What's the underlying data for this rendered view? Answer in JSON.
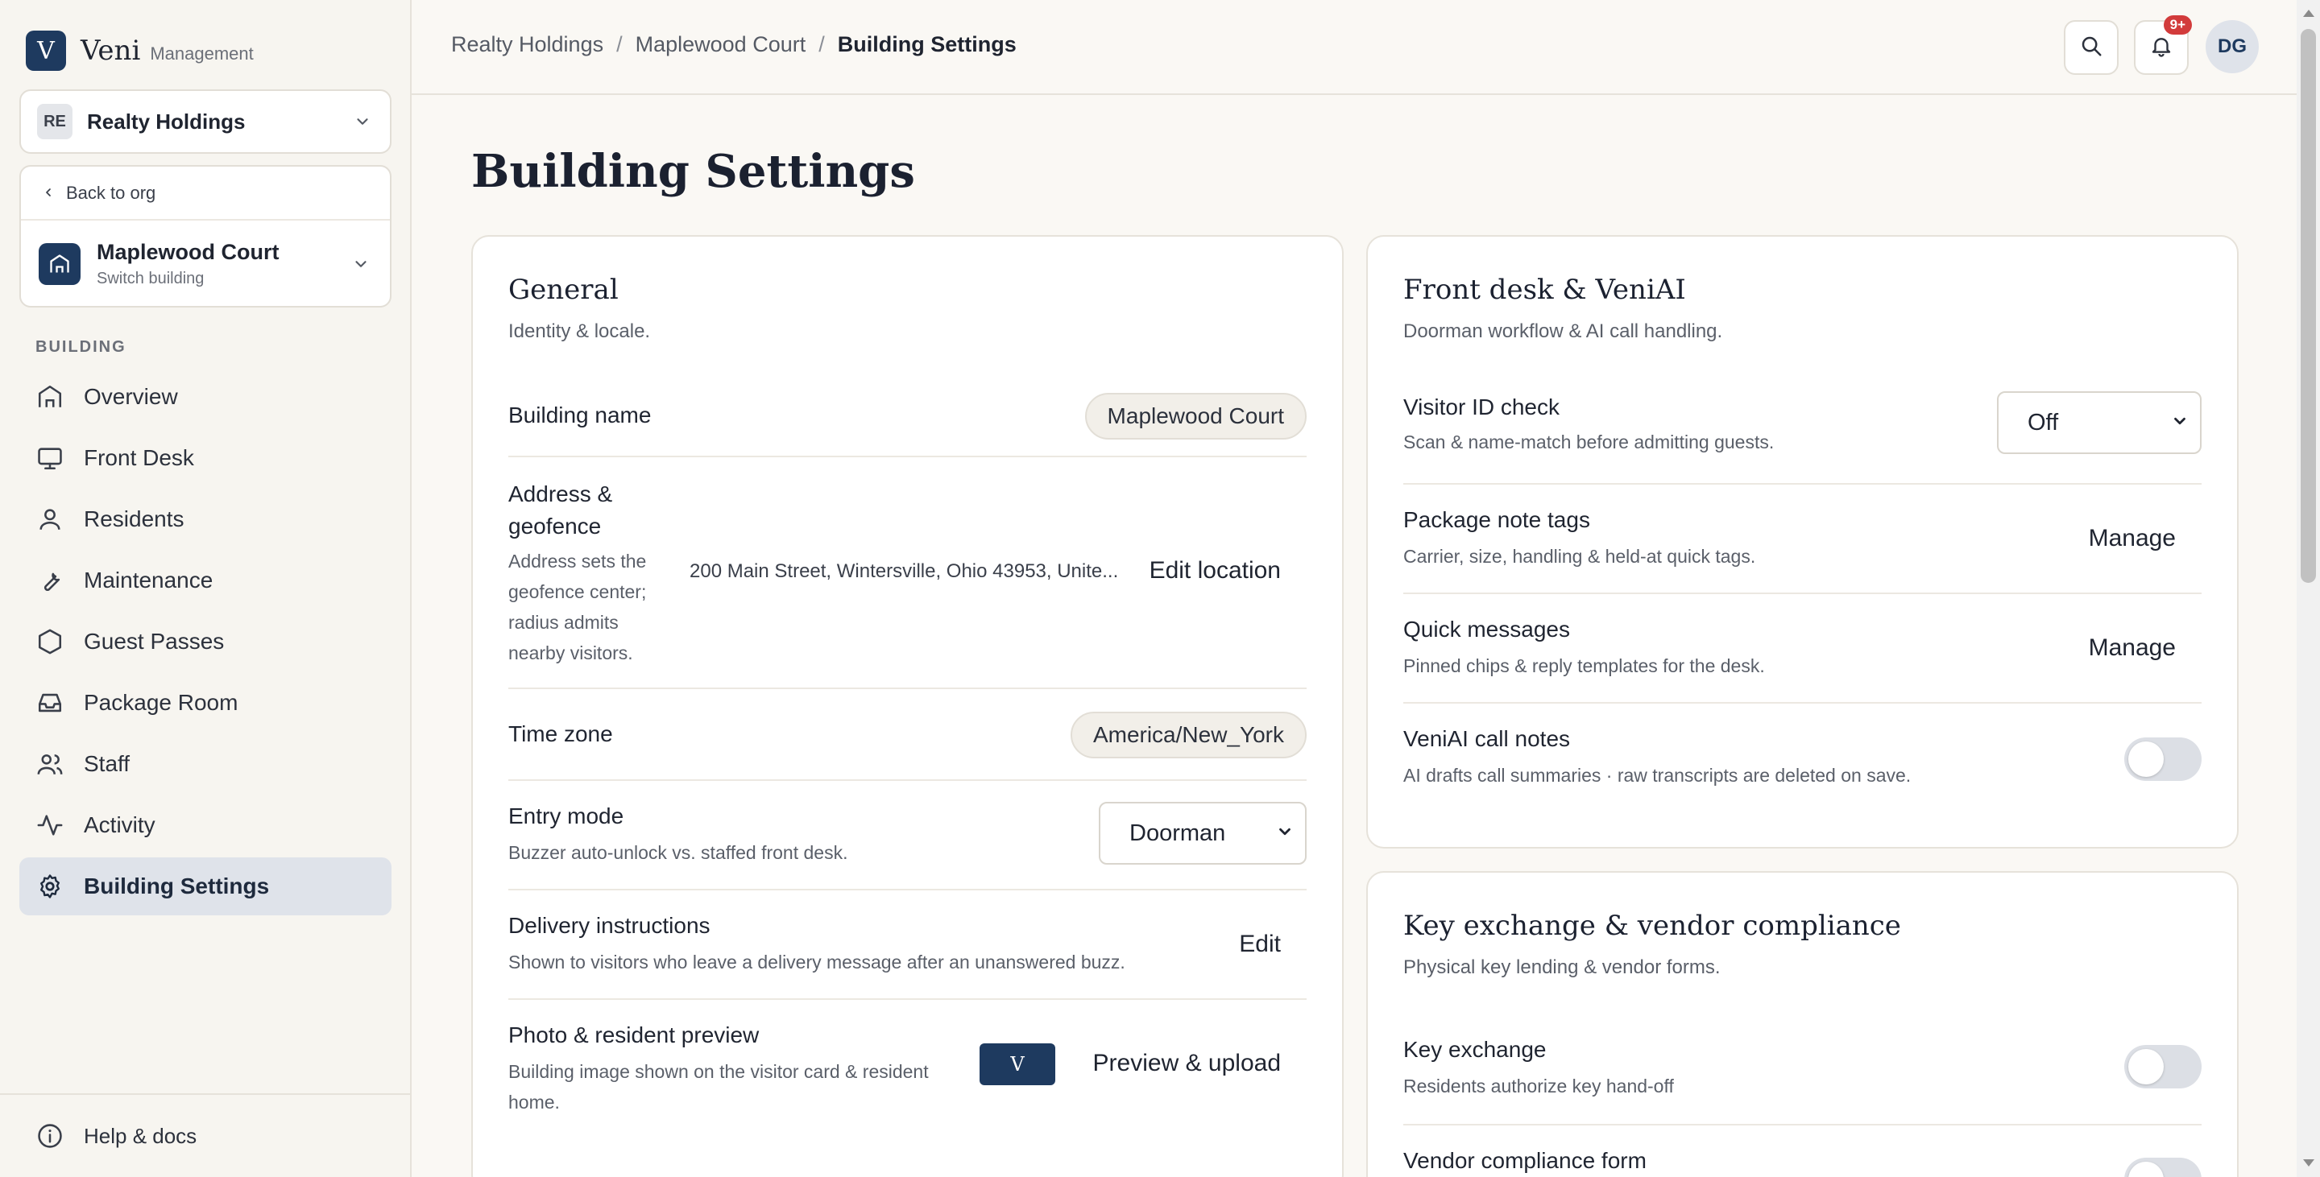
{
  "brand": {
    "logo_letter": "V",
    "name": "Veni",
    "sub": "Management"
  },
  "org": {
    "initials": "RE",
    "name": "Realty Holdings"
  },
  "building": {
    "back_label": "Back to org",
    "name": "Maplewood Court",
    "sub": "Switch building"
  },
  "sidebar": {
    "section_label": "BUILDING",
    "items": [
      {
        "label": "Overview",
        "icon": "home-icon"
      },
      {
        "label": "Front Desk",
        "icon": "monitor-icon"
      },
      {
        "label": "Residents",
        "icon": "user-icon"
      },
      {
        "label": "Maintenance",
        "icon": "wrench-icon"
      },
      {
        "label": "Guest Passes",
        "icon": "hexagon-icon"
      },
      {
        "label": "Package Room",
        "icon": "inbox-icon"
      },
      {
        "label": "Staff",
        "icon": "users-icon"
      },
      {
        "label": "Activity",
        "icon": "activity-icon"
      },
      {
        "label": "Building Settings",
        "icon": "gear-icon",
        "active": true
      }
    ],
    "help_label": "Help & docs"
  },
  "breadcrumb": {
    "org": "Realty Holdings",
    "building": "Maplewood Court",
    "current": "Building Settings"
  },
  "header": {
    "notification_badge": "9+",
    "user_initials": "DG"
  },
  "page": {
    "title": "Building Settings"
  },
  "general": {
    "title": "General",
    "subtitle": "Identity & locale.",
    "building_name_label": "Building name",
    "building_name_value": "Maplewood Court",
    "address_label": "Address & geofence",
    "address_desc": "Address sets the geofence center; radius admits nearby visitors.",
    "address_value": "200 Main Street, Wintersville, Ohio 43953, Unite...",
    "address_action": "Edit location",
    "timezone_label": "Time zone",
    "timezone_value": "America/New_York",
    "entry_label": "Entry mode",
    "entry_desc": "Buzzer auto-unlock vs. staffed front desk.",
    "entry_value": "Doorman",
    "delivery_label": "Delivery instructions",
    "delivery_desc": "Shown to visitors who leave a delivery message after an unanswered buzz.",
    "delivery_action": "Edit",
    "photo_label": "Photo & resident preview",
    "photo_desc": "Building image shown on the visitor card & resident home.",
    "photo_thumb_letter": "V",
    "photo_action": "Preview & upload"
  },
  "frontdesk": {
    "title": "Front desk & VeniAI",
    "subtitle": "Doorman workflow & AI call handling.",
    "visitor_label": "Visitor ID check",
    "visitor_desc": "Scan & name-match before admitting guests.",
    "visitor_value": "Off",
    "tags_label": "Package note tags",
    "tags_desc": "Carrier, size, handling & held-at quick tags.",
    "tags_action": "Manage",
    "quick_label": "Quick messages",
    "quick_desc": "Pinned chips & reply templates for the desk.",
    "quick_action": "Manage",
    "ai_label": "VeniAI call notes",
    "ai_desc": "AI drafts call summaries · raw transcripts are deleted on save.",
    "ai_enabled": false
  },
  "keyexchange": {
    "title": "Key exchange & vendor compliance",
    "subtitle": "Physical key lending & vendor forms.",
    "key_label": "Key exchange",
    "key_desc": "Residents authorize key hand-off",
    "key_enabled": false,
    "vendor_label": "Vendor compliance form",
    "vendor_enabled": false
  }
}
